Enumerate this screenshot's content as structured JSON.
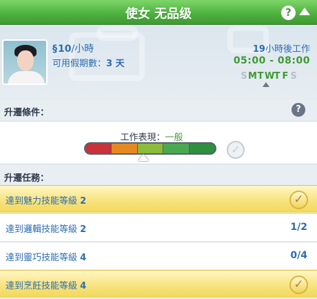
{
  "header": {
    "title": "使女 无品级",
    "help_label": "?"
  },
  "career": {
    "pay_symbol": "§",
    "pay_amount": "10",
    "pay_unit": "/小時",
    "vacation_label": "可用假期數：",
    "vacation_value": "3 天",
    "next_shift_hours": "19",
    "next_shift_text": "小時後工作",
    "shift_hours": "05:00 - 08:00",
    "days": [
      {
        "label": "S",
        "work": false
      },
      {
        "label": "M",
        "work": true
      },
      {
        "label": "T",
        "work": true
      },
      {
        "label": "W",
        "work": true
      },
      {
        "label": "T",
        "work": true
      },
      {
        "label": "F",
        "work": true
      },
      {
        "label": "S",
        "work": false
      }
    ],
    "today_index": 2
  },
  "promotion_requirements": {
    "label": "升遷條件：",
    "help_label": "?",
    "performance_label": "工作表現：",
    "performance_level": "一般",
    "performance_value": 0.45,
    "segment_colors": [
      "#c8323a",
      "#e58a22",
      "#8dbb3b",
      "#4aaa4f",
      "#2f8f3f"
    ],
    "check_symbol": "✓"
  },
  "promotion_tasks": {
    "label": "升遷任務：",
    "check_symbol": "✓",
    "items": [
      {
        "text": "達到魅力技能等級",
        "level": "2",
        "completed": true,
        "progress": ""
      },
      {
        "text": "達到邏輯技能等級",
        "level": "2",
        "completed": false,
        "progress": "1/2"
      },
      {
        "text": "達到靈巧技能等級",
        "level": "4",
        "completed": false,
        "progress": "0/4"
      },
      {
        "text": "達到烹飪技能等級",
        "level": "4",
        "completed": true,
        "progress": ""
      }
    ]
  },
  "colors": {
    "header_green": "#4fb23f",
    "text_blue": "#2e6db0",
    "shift_green": "#3f9a33",
    "complete_gold": "#f7e27a"
  },
  "icons": {
    "help": "question-mark-icon",
    "collapse": "triangle-up-icon",
    "check": "checkmark-icon",
    "pointer": "triangle-pointer-icon"
  }
}
